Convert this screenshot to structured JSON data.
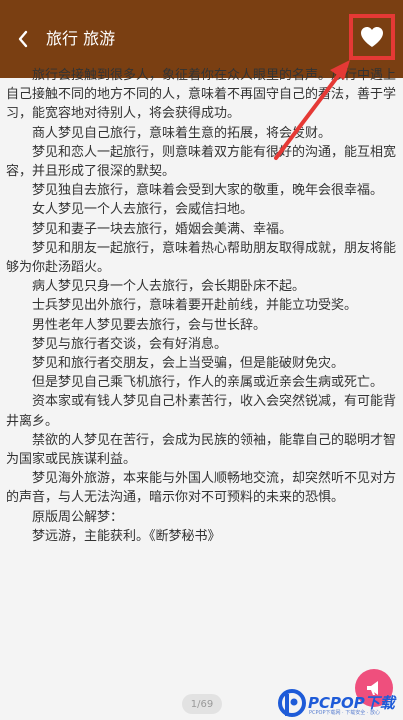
{
  "header": {
    "title": "旅行 旅游",
    "back_icon": "back-chevron-icon",
    "favorite_icon": "heart-icon"
  },
  "content": {
    "paragraphs": [
      "旅行会接触到很多人，象征着你在众人眼里的名声。旅行中遇上自己接触不同的地方不同的人，意味着不再固守自己的看法，善于学习，能宽容地对待别人，将会获得成功。",
      "商人梦见自己旅行，意味着生意的拓展，将会发财。",
      "梦见和恋人一起旅行，则意味着双方能有很好的沟通，能互相宽容，并且形成了很深的默契。",
      "梦见独自去旅行，意味着会受到大家的敬重，晚年会很幸福。",
      "女人梦见一个人去旅行，会威信扫地。",
      "梦见和妻子一块去旅行，婚姻会美满、幸福。",
      "梦见和朋友一起旅行，意味着热心帮助朋友取得成就，朋友将能够为你赴汤蹈火。",
      "病人梦见只身一个人去旅行，会长期卧床不起。",
      "士兵梦见出外旅行，意味着要开赴前线，并能立功受奖。",
      "男性老年人梦见要去旅行，会与世长辞。",
      "梦见与旅行者交谈，会有好消息。",
      "梦见和旅行者交朋友，会上当受骗，但是能破财免灾。",
      "但是梦见自己乘飞机旅行，作人的亲属或近亲会生病或死亡。",
      "资本家或有钱人梦见自己朴素苦行，收入会突然锐减，有可能背井离乡。",
      "禁欲的人梦见在苦行，会成为民族的领袖，能靠自己的聪明才智为国家或民族谋利益。",
      "梦见海外旅游，本来能与外国人顺畅地交流，却突然听不见对方的声音，与人无法沟通，暗示你对不可预料的未来的恐惧。",
      "原版周公解梦：",
      "梦远游，主能获利。《断梦秘书》"
    ]
  },
  "pager": {
    "label": "1/69"
  },
  "share_button": {
    "icon": "megaphone-icon"
  },
  "watermark": {
    "brand": "PCPOP下载",
    "sub": "PCPOP下载网 · 下载安全 · 放心"
  },
  "colors": {
    "header_bg": "#7a3f12",
    "highlight": "#e53935",
    "fab": "#ef4f7d",
    "text": "#333333",
    "page_bg": "#f4f4f4"
  }
}
